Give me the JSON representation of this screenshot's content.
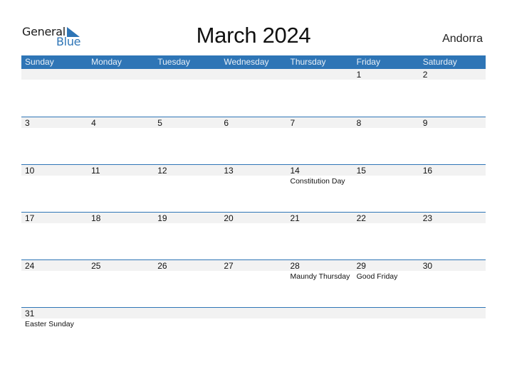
{
  "logo": {
    "word1": "General",
    "word2": "Blue",
    "icon": "triangle-flag-icon",
    "color": "#2e75b6"
  },
  "title": "March 2024",
  "country": "Andorra",
  "colors": {
    "header_bg": "#2e75b6",
    "row_bg": "#f2f2f2",
    "row_border": "#2e75b6"
  },
  "weekdays": [
    "Sunday",
    "Monday",
    "Tuesday",
    "Wednesday",
    "Thursday",
    "Friday",
    "Saturday"
  ],
  "weeks": [
    [
      {
        "day": "",
        "holiday": ""
      },
      {
        "day": "",
        "holiday": ""
      },
      {
        "day": "",
        "holiday": ""
      },
      {
        "day": "",
        "holiday": ""
      },
      {
        "day": "",
        "holiday": ""
      },
      {
        "day": "1",
        "holiday": ""
      },
      {
        "day": "2",
        "holiday": ""
      }
    ],
    [
      {
        "day": "3",
        "holiday": ""
      },
      {
        "day": "4",
        "holiday": ""
      },
      {
        "day": "5",
        "holiday": ""
      },
      {
        "day": "6",
        "holiday": ""
      },
      {
        "day": "7",
        "holiday": ""
      },
      {
        "day": "8",
        "holiday": ""
      },
      {
        "day": "9",
        "holiday": ""
      }
    ],
    [
      {
        "day": "10",
        "holiday": ""
      },
      {
        "day": "11",
        "holiday": ""
      },
      {
        "day": "12",
        "holiday": ""
      },
      {
        "day": "13",
        "holiday": ""
      },
      {
        "day": "14",
        "holiday": "Constitution Day"
      },
      {
        "day": "15",
        "holiday": ""
      },
      {
        "day": "16",
        "holiday": ""
      }
    ],
    [
      {
        "day": "17",
        "holiday": ""
      },
      {
        "day": "18",
        "holiday": ""
      },
      {
        "day": "19",
        "holiday": ""
      },
      {
        "day": "20",
        "holiday": ""
      },
      {
        "day": "21",
        "holiday": ""
      },
      {
        "day": "22",
        "holiday": ""
      },
      {
        "day": "23",
        "holiday": ""
      }
    ],
    [
      {
        "day": "24",
        "holiday": ""
      },
      {
        "day": "25",
        "holiday": ""
      },
      {
        "day": "26",
        "holiday": ""
      },
      {
        "day": "27",
        "holiday": ""
      },
      {
        "day": "28",
        "holiday": "Maundy Thursday"
      },
      {
        "day": "29",
        "holiday": "Good Friday"
      },
      {
        "day": "30",
        "holiday": ""
      }
    ],
    [
      {
        "day": "31",
        "holiday": "Easter Sunday"
      },
      {
        "day": "",
        "holiday": ""
      },
      {
        "day": "",
        "holiday": ""
      },
      {
        "day": "",
        "holiday": ""
      },
      {
        "day": "",
        "holiday": ""
      },
      {
        "day": "",
        "holiday": ""
      },
      {
        "day": "",
        "holiday": ""
      }
    ]
  ]
}
